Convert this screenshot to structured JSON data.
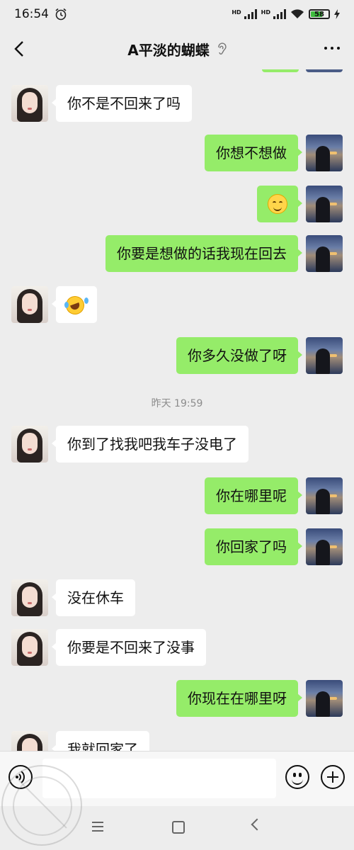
{
  "status": {
    "time": "16:54",
    "signal1_label": "HD",
    "signal2_label": "HD",
    "battery": "58"
  },
  "header": {
    "title": "A平淡的蝴蝶"
  },
  "messages": [
    {
      "from": "her",
      "text": "你不是不回来了吗"
    },
    {
      "from": "me",
      "text": "你想不想做"
    },
    {
      "from": "me",
      "emoji": "smile-emoji"
    },
    {
      "from": "me",
      "text": "你要是想做的话我现在回去"
    },
    {
      "from": "her",
      "emoji": "laugh-cry-emoji"
    },
    {
      "from": "me",
      "text": "你多久没做了呀"
    },
    {
      "timestamp": "昨天 19:59"
    },
    {
      "from": "her",
      "text": "你到了找我吧我车子没电了"
    },
    {
      "from": "me",
      "text": "你在哪里呢"
    },
    {
      "from": "me",
      "text": "你回家了吗"
    },
    {
      "from": "her",
      "text": "没在休车"
    },
    {
      "from": "her",
      "text": "你要是不回来了没事"
    },
    {
      "from": "me",
      "text": "你现在在哪里呀"
    },
    {
      "from": "her",
      "text": "我就回家了"
    }
  ],
  "input": {
    "value": ""
  },
  "icons": {
    "back": "chevron-left-icon",
    "more": "more-dots-icon",
    "ear": "ear-icon",
    "voice": "voice-icon",
    "emoji": "emoji-icon",
    "plus": "plus-icon"
  },
  "colors": {
    "my_bubble": "#95ec69",
    "her_bubble": "#ffffff",
    "background": "#ededed"
  }
}
